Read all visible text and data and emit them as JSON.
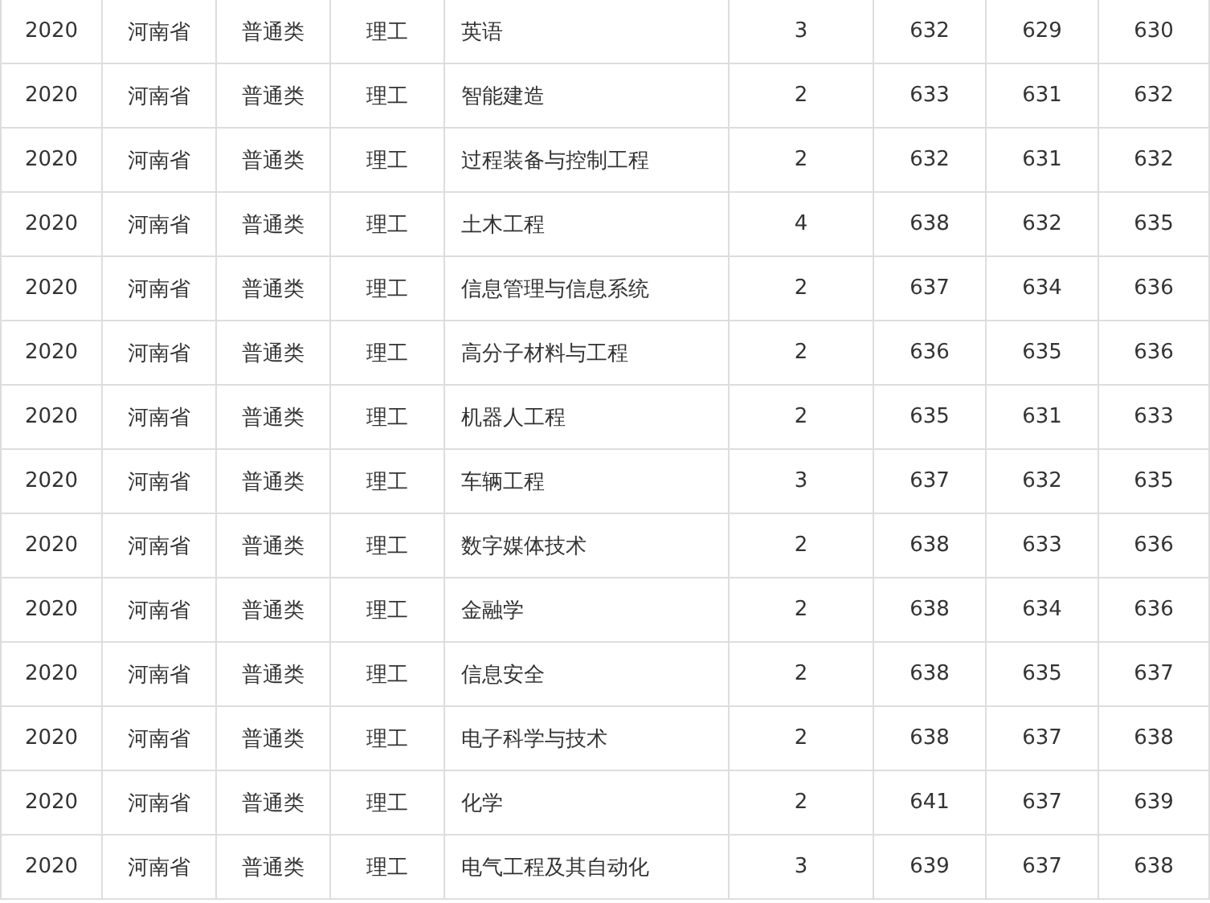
{
  "table": {
    "rows": [
      [
        "2020",
        "河南省",
        "普通类",
        "理工",
        "英语",
        "3",
        "632",
        "629",
        "630"
      ],
      [
        "2020",
        "河南省",
        "普通类",
        "理工",
        "智能建造",
        "2",
        "633",
        "631",
        "632"
      ],
      [
        "2020",
        "河南省",
        "普通类",
        "理工",
        "过程装备与控制工程",
        "2",
        "632",
        "631",
        "632"
      ],
      [
        "2020",
        "河南省",
        "普通类",
        "理工",
        "土木工程",
        "4",
        "638",
        "632",
        "635"
      ],
      [
        "2020",
        "河南省",
        "普通类",
        "理工",
        "信息管理与信息系统",
        "2",
        "637",
        "634",
        "636"
      ],
      [
        "2020",
        "河南省",
        "普通类",
        "理工",
        "高分子材料与工程",
        "2",
        "636",
        "635",
        "636"
      ],
      [
        "2020",
        "河南省",
        "普通类",
        "理工",
        "机器人工程",
        "2",
        "635",
        "631",
        "633"
      ],
      [
        "2020",
        "河南省",
        "普通类",
        "理工",
        "车辆工程",
        "3",
        "637",
        "632",
        "635"
      ],
      [
        "2020",
        "河南省",
        "普通类",
        "理工",
        "数字媒体技术",
        "2",
        "638",
        "633",
        "636"
      ],
      [
        "2020",
        "河南省",
        "普通类",
        "理工",
        "金融学",
        "2",
        "638",
        "634",
        "636"
      ],
      [
        "2020",
        "河南省",
        "普通类",
        "理工",
        "信息安全",
        "2",
        "638",
        "635",
        "637"
      ],
      [
        "2020",
        "河南省",
        "普通类",
        "理工",
        "电子科学与技术",
        "2",
        "638",
        "637",
        "638"
      ],
      [
        "2020",
        "河南省",
        "普通类",
        "理工",
        "化学",
        "2",
        "641",
        "637",
        "639"
      ],
      [
        "2020",
        "河南省",
        "普通类",
        "理工",
        "电气工程及其自动化",
        "3",
        "639",
        "637",
        "638"
      ]
    ]
  }
}
